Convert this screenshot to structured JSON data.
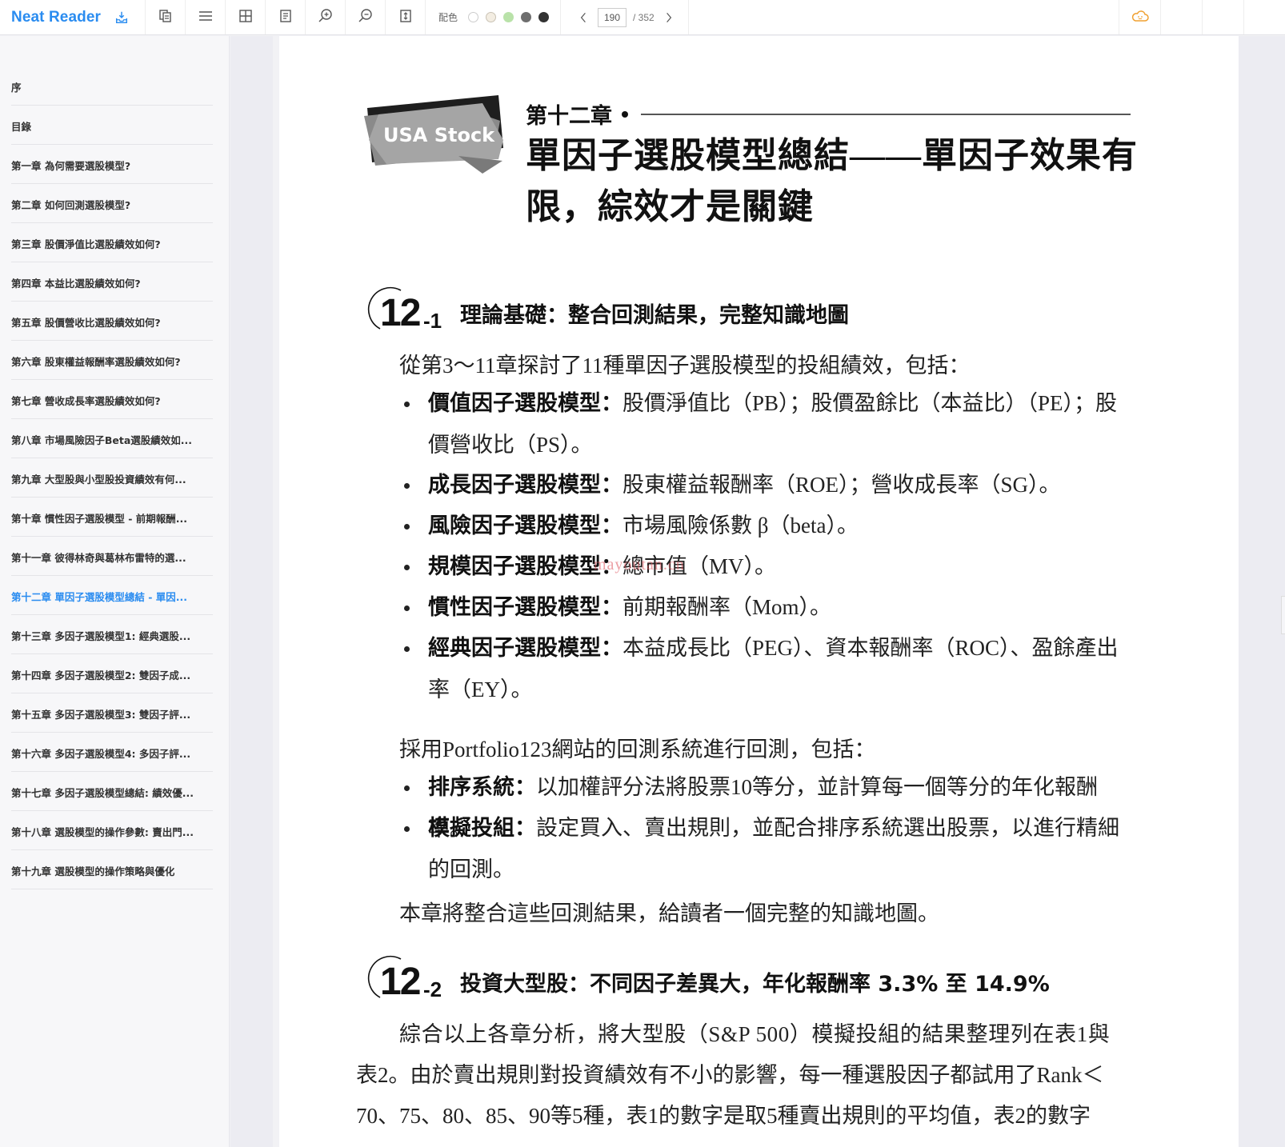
{
  "app": {
    "title": "Neat Reader",
    "accent_color": "#2a8cf0"
  },
  "toolbar": {
    "icons": [
      "download-icon",
      "copy-icon",
      "menu-icon",
      "grid-icon",
      "notes-icon",
      "zoom-in-icon",
      "zoom-out-icon",
      "fit-height-icon"
    ],
    "color_label": "配色",
    "color_swatches": [
      "#ffffff",
      "#f3ede2",
      "#b9e2a9",
      "#6e6e6e",
      "#333333"
    ],
    "page_current": "190",
    "page_total": "/ 352",
    "right_icons": [
      "cloud-icon",
      "search-icon",
      "fullscreen-icon",
      "collapse-up-icon"
    ]
  },
  "sidebar": {
    "items": [
      {
        "label": "序"
      },
      {
        "label": "目錄"
      },
      {
        "label": "第一章 為何需要選股模型?"
      },
      {
        "label": "第二章 如何回測選股模型?"
      },
      {
        "label": "第三章 股價淨值比選股績效如何?"
      },
      {
        "label": "第四章 本益比選股績效如何?"
      },
      {
        "label": "第五章 股價營收比選股績效如何?"
      },
      {
        "label": "第六章 股東權益報酬率選股績效如何?"
      },
      {
        "label": "第七章 營收成長率選股績效如何?"
      },
      {
        "label": "第八章 市場風險因子Beta選股績效如..."
      },
      {
        "label": "第九章 大型股與小型股投資績效有何..."
      },
      {
        "label": "第十章 慣性因子選股模型 - 前期報酬..."
      },
      {
        "label": "第十一章 彼得林奇與葛林布雷特的選..."
      },
      {
        "label": "第十二章 單因子選股模型總結 - 單因...",
        "active": true
      },
      {
        "label": "第十三章 多因子選股模型1: 經典選股..."
      },
      {
        "label": "第十四章 多因子選股模型2: 雙因子成..."
      },
      {
        "label": "第十五章 多因子選股模型3: 雙因子評..."
      },
      {
        "label": "第十六章 多因子選股模型4: 多因子評..."
      },
      {
        "label": "第十七章 多因子選股模型總結: 績效優..."
      },
      {
        "label": "第十八章 選股模型的操作參數: 賣出門..."
      },
      {
        "label": "第十九章 選股模型的操作策略與優化"
      }
    ]
  },
  "page": {
    "badge_text": "USA Stock",
    "chapter_label": "第十二章",
    "chapter_title_line1": "單因子選股模型總結——單因子效果有",
    "chapter_title_line2": "限，綜效才是關鍵",
    "section1": {
      "num": "12",
      "sub": "-1",
      "title": "理論基礎：整合回測結果，完整知識地圖"
    },
    "intro1": "從第3～11章探討了11種單因子選股模型的投組績效，包括：",
    "bullets1": [
      {
        "bold": "價值因子選股模型：",
        "text": "股價淨值比（PB）；股價盈餘比（本益比）（PE）；股價營收比（PS）。"
      },
      {
        "bold": "成長因子選股模型：",
        "text": "股東權益報酬率（ROE）；營收成長率（SG）。"
      },
      {
        "bold": "風險因子選股模型：",
        "text": "市場風險係數 β（beta）。"
      },
      {
        "bold": "規模因子選股模型：",
        "text": "總市值（MV）。"
      },
      {
        "bold": "慣性因子選股模型：",
        "text": "前期報酬率（Mom）。"
      },
      {
        "bold": "經典因子選股模型：",
        "text": "本益成長比（PEG）、資本報酬率（ROC）、盈餘產出率（EY）。"
      }
    ],
    "intro2": "採用Portfolio123網站的回測系統進行回測，包括：",
    "bullets2": [
      {
        "bold": "排序系統：",
        "text": "以加權評分法將股票10等分，並計算每一個等分的年化報酬率。"
      },
      {
        "bold": "模擬投組：",
        "text": "設定買入、賣出規則，並配合排序系統選出股票，以進行精細的回測。"
      }
    ],
    "outro": "本章將整合這些回測結果，給讀者一個完整的知識地圖。",
    "section2": {
      "num": "12",
      "sub": "-2",
      "title": "投資大型股：不同因子差異大，年化報酬率 3.3% 至 14.9%"
    },
    "body2_line1": "綜合以上各章分析，將大型股（S&P 500）模擬投組的結果整理列在表1與",
    "body2_line2": "表2。由於賣出規則對投資績效有不小的影響，每一種選股因子都試用了Rank＜",
    "body2_line3": "70、75、80、85、90等5種，表1的數字是取5種賣出規則的平均值，表2的數字",
    "watermark": "mayoutan.cn"
  }
}
